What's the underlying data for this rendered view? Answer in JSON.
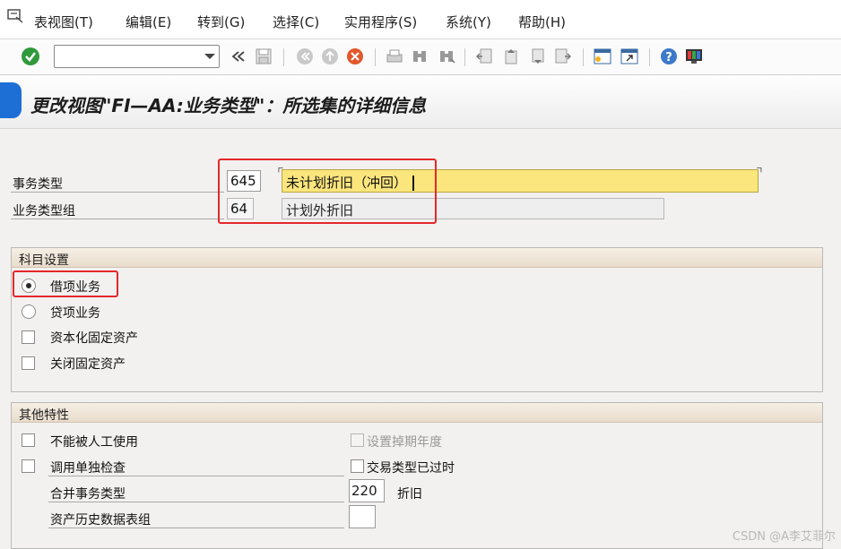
{
  "menu": {
    "items": [
      "表视图(T)",
      "编辑(E)",
      "转到(G)",
      "选择(C)",
      "实用程序(S)",
      "系统(Y)",
      "帮助(H)"
    ]
  },
  "toolbar": {
    "command_value": "",
    "icons": [
      "enter-check-icon",
      "back-arrows-icon",
      "save-icon",
      "nav-back-icon",
      "nav-exit-icon",
      "cancel-icon",
      "print-icon",
      "find-icon",
      "find-next-icon",
      "first-page-icon",
      "prev-page-icon",
      "next-page-icon",
      "last-page-icon",
      "new-session-icon",
      "shortcut-icon",
      "help-icon",
      "customize-layout-icon"
    ]
  },
  "title": "更改视图\"FI—AA:业务类型\"：所选集的详细信息",
  "header": {
    "transaction_type_label": "事务类型",
    "transaction_type_code": "645",
    "transaction_type_desc": "未计划折旧（冲回）",
    "transaction_group_label": "业务类型组",
    "transaction_group_code": "64",
    "transaction_group_desc": "计划外折旧"
  },
  "account_settings": {
    "title": "科目设置",
    "options": [
      {
        "label": "借项业务",
        "type": "radio",
        "checked": true
      },
      {
        "label": "贷项业务",
        "type": "radio",
        "checked": false
      },
      {
        "label": "资本化固定资产",
        "type": "checkbox",
        "checked": false
      },
      {
        "label": "关闭固定资产",
        "type": "checkbox",
        "checked": false
      }
    ]
  },
  "other_features": {
    "title": "其他特性",
    "no_manual_use": "不能被人工使用",
    "call_individual_check": "调用单独检查",
    "set_writeoff_year": "设置掉期年度",
    "transaction_type_obsolete": "交易类型已过时",
    "consolidated_type_label": "合并事务类型",
    "consolidated_type_code": "220",
    "consolidated_type_desc": "折旧",
    "asset_history_label": "资产历史数据表组",
    "asset_history_value": ""
  },
  "watermark": "CSDN @A李艾菲尔",
  "colors": {
    "highlight_box": "#e4272a",
    "required_field": "#fbe57d",
    "accept_green": "#2f9a3a"
  }
}
